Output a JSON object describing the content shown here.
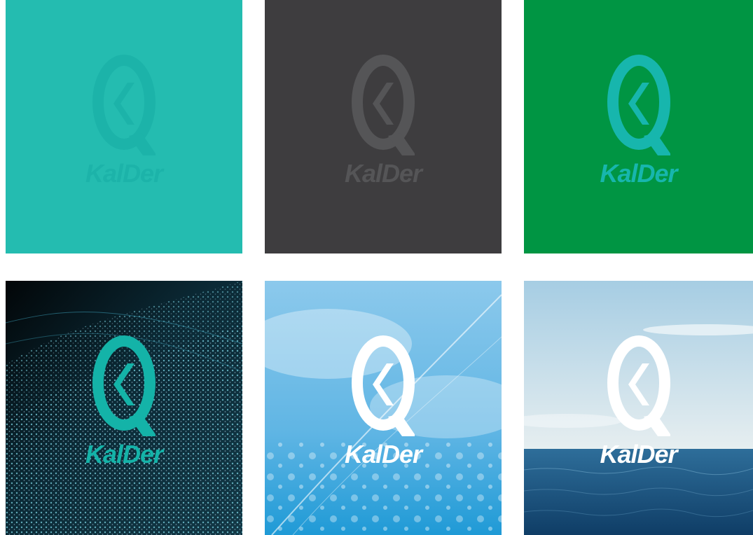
{
  "brand_name": "KalDer",
  "panels": [
    {
      "id": "teal",
      "background": "#24bcb0",
      "logo_color": "#1cb3a9"
    },
    {
      "id": "dark",
      "background": "#3e3d3f",
      "logo_color": "#555557"
    },
    {
      "id": "green",
      "background": "#009543",
      "logo_color": "#17b6ad"
    },
    {
      "id": "digital-waves",
      "background": "#0b1a24",
      "logo_color": "#14b3a8"
    },
    {
      "id": "sky-feather",
      "background": "#6fb8e3",
      "logo_color": "#ffffff"
    },
    {
      "id": "sea-horizon",
      "background": "#1f5c8c",
      "logo_color": "#ffffff"
    }
  ],
  "icons": {
    "logo": "kalder-q-chevron-icon"
  }
}
